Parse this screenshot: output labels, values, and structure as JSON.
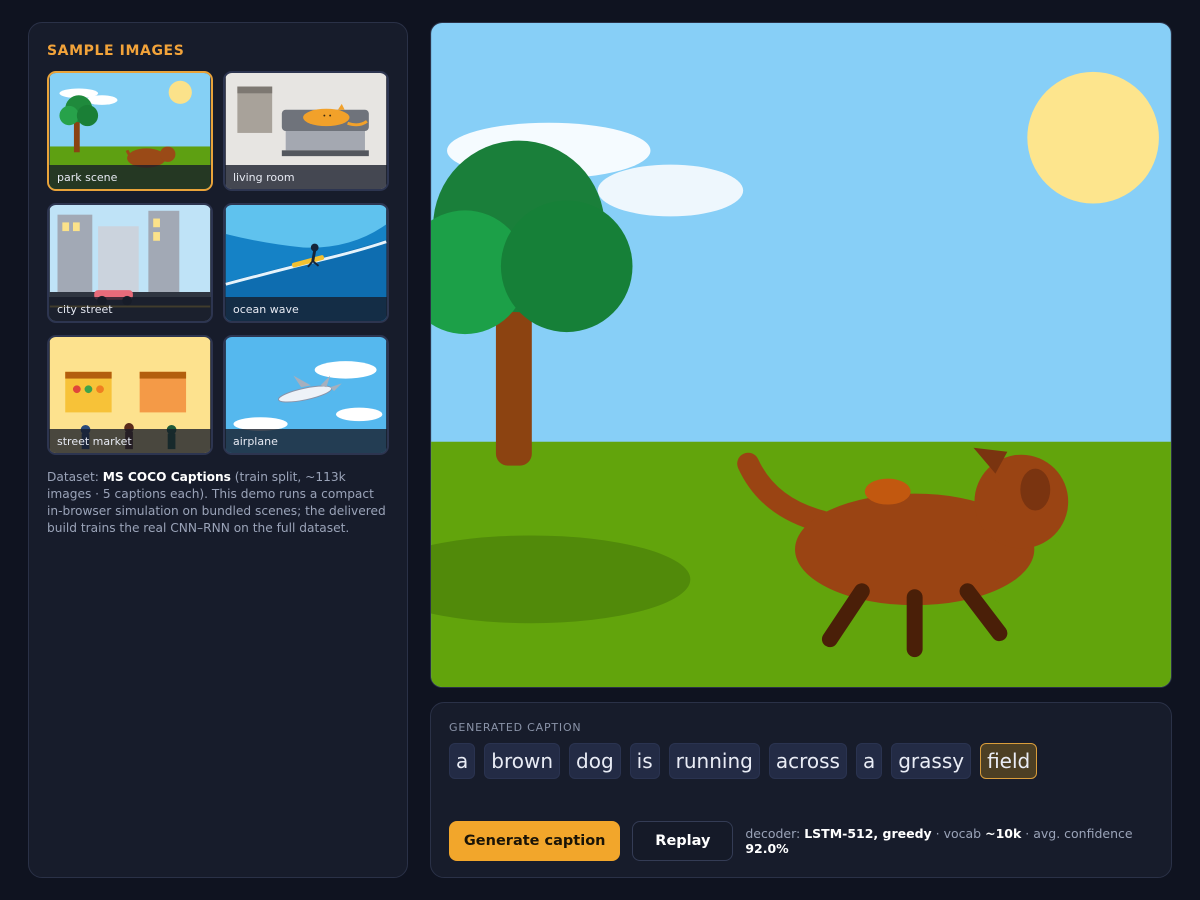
{
  "sidebar": {
    "title": "SAMPLE IMAGES",
    "thumbnails": [
      {
        "label": "park scene",
        "selected": true
      },
      {
        "label": "living room",
        "selected": false
      },
      {
        "label": "city street",
        "selected": false
      },
      {
        "label": "ocean wave",
        "selected": false
      },
      {
        "label": "street market",
        "selected": false
      },
      {
        "label": "airplane",
        "selected": false
      }
    ],
    "dataset": {
      "prefix": "Dataset: ",
      "name": "MS COCO Captions",
      "detail": " (train split, ~113k images · 5 captions each). This demo runs a compact in-browser simulation on bundled scenes; the delivered build trains the real CNN–RNN on the full dataset."
    }
  },
  "caption": {
    "heading": "GENERATED CAPTION",
    "tokens": [
      "a",
      "brown",
      "dog",
      "is",
      "running",
      "across",
      "a",
      "grassy",
      "field"
    ],
    "active_token_index": 8
  },
  "controls": {
    "generate_label": "Generate caption",
    "replay_label": "Replay",
    "meta": {
      "decoder_prefix": "decoder: ",
      "decoder_value": "LSTM-512, greedy",
      "vocab_prefix": " · vocab ",
      "vocab_value": "~10k",
      "confidence_prefix": " · avg. confidence ",
      "confidence_value": "92.0%"
    }
  },
  "colors": {
    "accent": "#f2a62b",
    "panel": "#171c2b",
    "background": "#0f1320",
    "token": "#232b45",
    "token_active": "#4c3f24"
  }
}
